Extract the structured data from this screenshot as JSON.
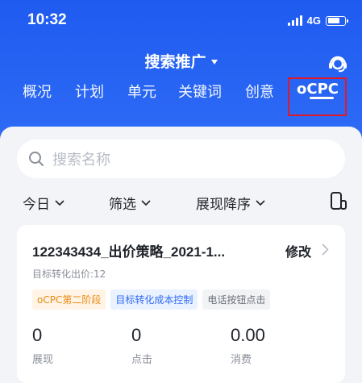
{
  "status_bar": {
    "time": "10:32",
    "network": "4G"
  },
  "header": {
    "title": "搜索推广",
    "icons": [
      "chevron-down-icon",
      "support-icon"
    ]
  },
  "tabs": [
    {
      "label": "概况"
    },
    {
      "label": "计划"
    },
    {
      "label": "单元"
    },
    {
      "label": "关键词"
    },
    {
      "label": "创意"
    },
    {
      "label": "oCPC",
      "active": true
    }
  ],
  "search": {
    "placeholder": "搜索名称"
  },
  "filters": [
    {
      "label": "今日"
    },
    {
      "label": "筛选"
    },
    {
      "label": "展现降序"
    }
  ],
  "card": {
    "title": "122343434_出价策略_2021-1...",
    "edit_label": "修改",
    "subtitle": "目标转化出价:12",
    "tags": [
      "oCPC第二阶段",
      "目标转化成本控制",
      "电话按钮点击"
    ],
    "metrics": [
      {
        "value": "0",
        "label": "展现"
      },
      {
        "value": "0",
        "label": "点击"
      },
      {
        "value": "0.00",
        "label": "消费"
      }
    ]
  },
  "colors": {
    "brand_blue": "#2f6cf5",
    "highlight_red": "#e0192b",
    "tag_orange": "#e88a14"
  }
}
